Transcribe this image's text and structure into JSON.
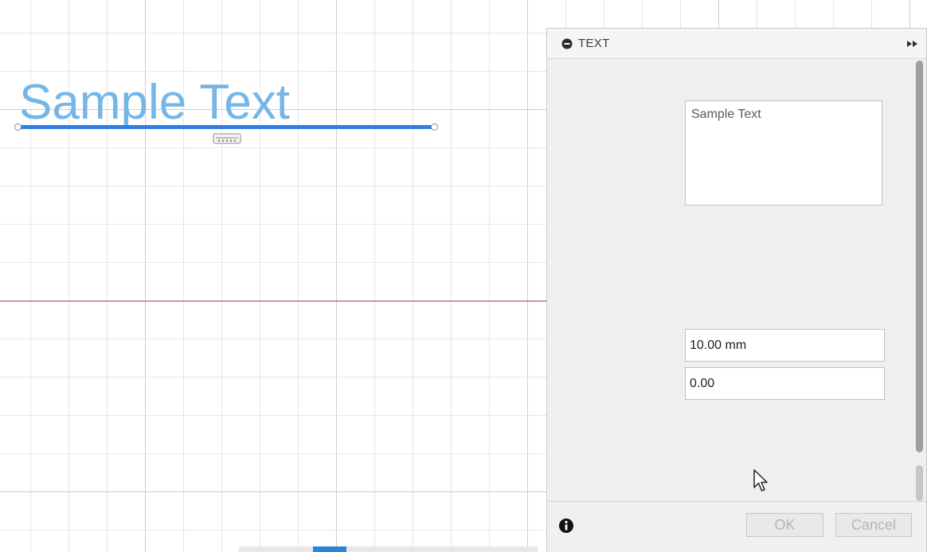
{
  "canvas": {
    "sketch_text": "Sample Text"
  },
  "dialog": {
    "title": "TEXT",
    "text_value": "Sample Text",
    "height_value": "10.00 mm",
    "angle_value": "0.00",
    "ok_label": "OK",
    "cancel_label": "Cancel"
  },
  "icons": {
    "collapse": "collapse-circle-icon",
    "expand": "fast-forward-icon",
    "info": "info-icon",
    "cursor": "mouse-pointer-icon",
    "text_handle": "text-move-handle-icon"
  },
  "colors": {
    "sketch_text": "#74b6e6",
    "baseline": "#2d7fe3",
    "x_axis": "#e08f8f",
    "accent": "#2a86d3"
  }
}
